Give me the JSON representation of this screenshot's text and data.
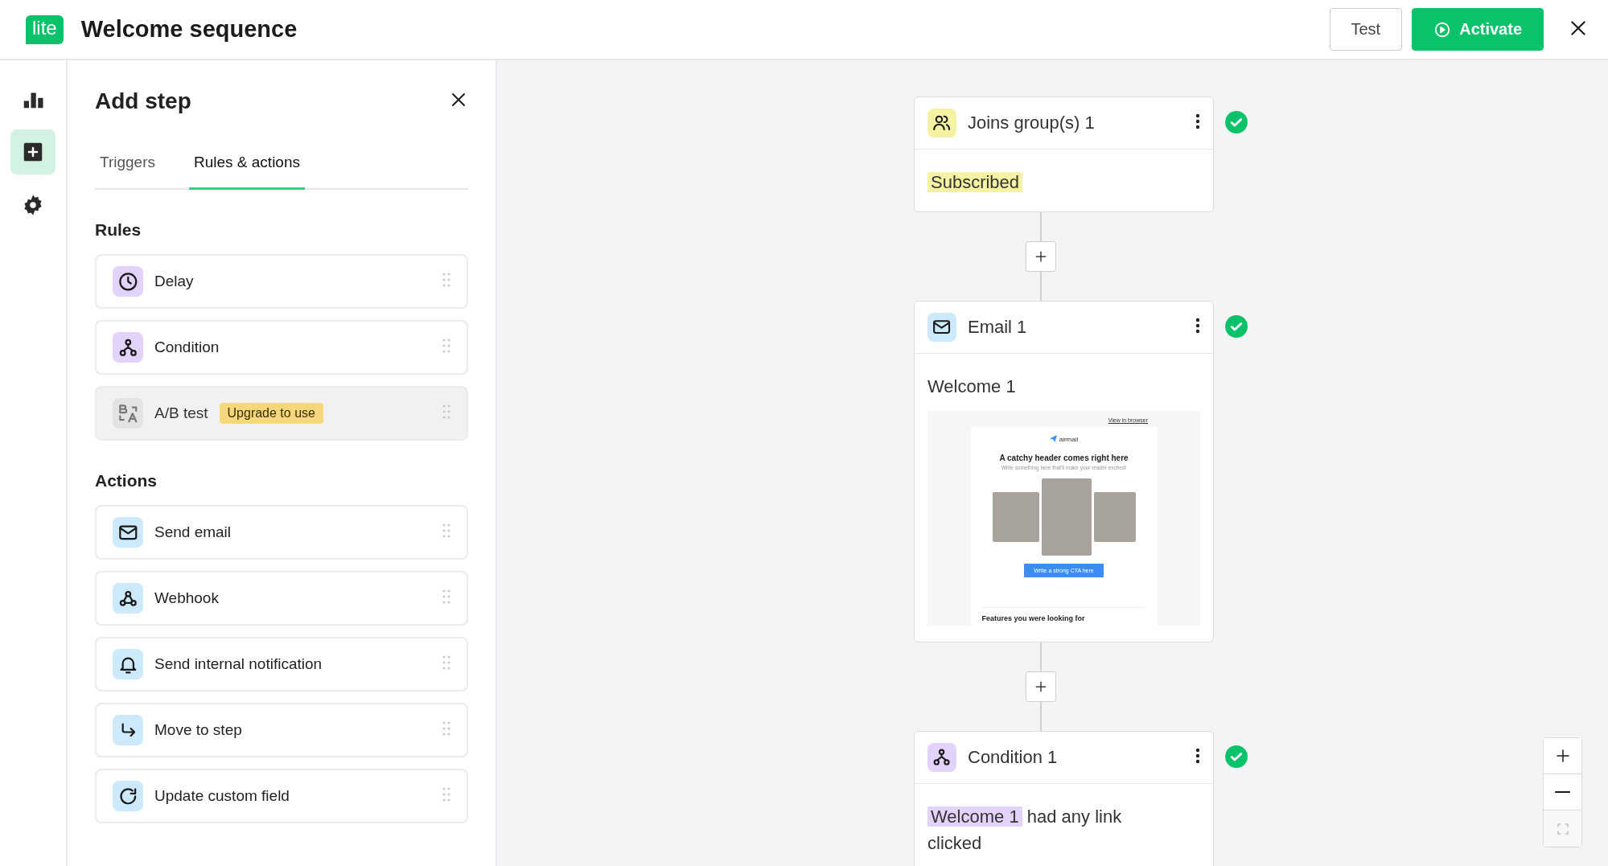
{
  "header": {
    "logo": "lite",
    "title": "Welcome sequence",
    "buttons": [
      {
        "label": "Test",
        "kind": "secondary"
      },
      {
        "label": "Activate",
        "kind": "primary"
      }
    ]
  },
  "rail": {
    "items": [
      {
        "kind": "reports",
        "selected": false
      },
      {
        "kind": "add",
        "selected": true
      },
      {
        "kind": "settings",
        "selected": false
      }
    ]
  },
  "panel": {
    "title": "Add step",
    "tabs": [
      {
        "label": "Triggers",
        "selected": false
      },
      {
        "label": "Rules & actions",
        "selected": true
      }
    ],
    "sections": [
      {
        "heading": "Rules",
        "items": [
          {
            "kind": "delay",
            "label": "Delay",
            "disabled": false
          },
          {
            "kind": "condition",
            "label": "Condition",
            "disabled": false
          },
          {
            "kind": "abtest",
            "label": "A/B test",
            "badge": "Upgrade to use",
            "disabled": true
          }
        ]
      },
      {
        "heading": "Actions",
        "items": [
          {
            "kind": "email",
            "label": "Send email",
            "disabled": false
          },
          {
            "kind": "webhook",
            "label": "Webhook",
            "disabled": false
          },
          {
            "kind": "notification",
            "label": "Send internal notification",
            "disabled": false
          },
          {
            "kind": "move",
            "label": "Move to step",
            "disabled": false
          },
          {
            "kind": "update",
            "label": "Update custom field",
            "disabled": false
          }
        ]
      }
    ]
  },
  "canvas": {
    "steps": [
      {
        "kind": "trigger",
        "title": "Joins group(s) 1",
        "complete": true,
        "body": {
          "kind": "tag",
          "tag": "Subscribed"
        }
      },
      {
        "kind": "email",
        "title": "Email 1",
        "complete": true,
        "body": {
          "kind": "email",
          "subject": "Welcome 1",
          "preview": {
            "browser_link": "View in browser",
            "brand": "airmail",
            "headline": "A catchy header comes right here",
            "subline": "Write something here that'll make your reader excited!",
            "cta": "Write a strong CTA here",
            "section_title": "Features you were looking for"
          }
        }
      },
      {
        "kind": "condition",
        "title": "Condition 1",
        "complete": true,
        "body": {
          "kind": "condition",
          "tag": "Welcome 1",
          "text": "had any link clicked"
        }
      }
    ]
  }
}
